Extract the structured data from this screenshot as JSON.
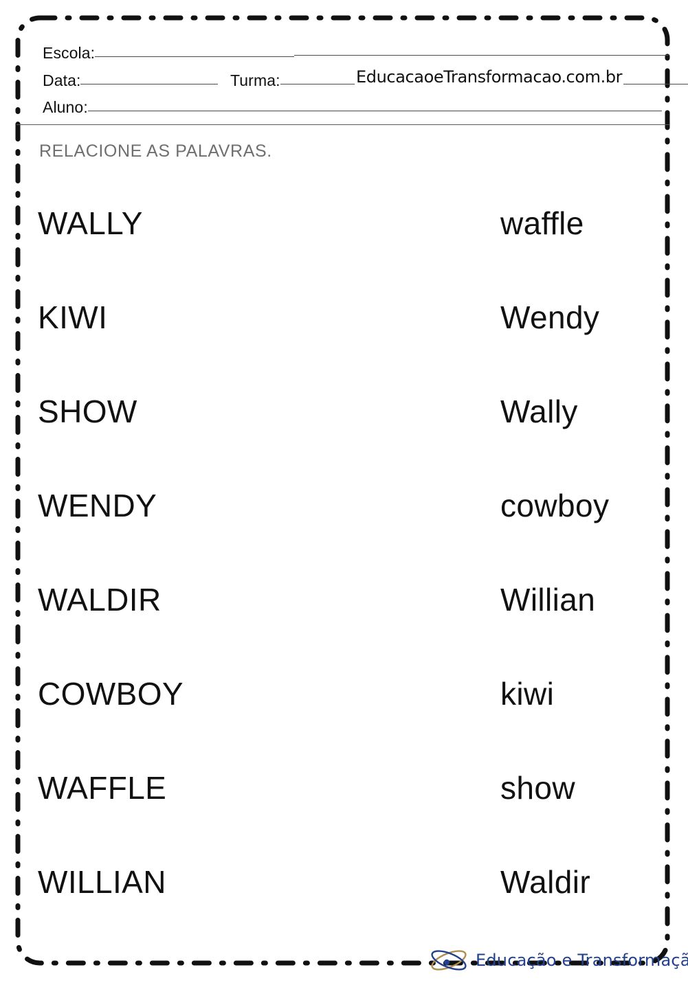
{
  "page": {
    "title": "RELACIONE AS PALAVRAS."
  },
  "header": {
    "fields": [
      {
        "label": "Escola:"
      },
      {
        "label": "Data:"
      },
      {
        "label": "Turma:"
      },
      {
        "label": "Aluno:"
      }
    ],
    "escola_label": "Escola:",
    "data_label": "Data:",
    "turma_label": "Turma:",
    "aluno_label": "Aluno:",
    "watermark": "EducacaoeTransformacao.com.br"
  },
  "instruction": "RELACIONE AS PALAVRAS.",
  "exercise": {
    "type": "matching",
    "left_column": [
      "WALLY",
      "KIWI",
      "SHOW",
      "WENDY",
      "WALDIR",
      "COWBOY",
      "WAFFLE",
      "WILLIAN"
    ],
    "right_column": [
      "waffle",
      "Wendy",
      "Wally",
      "cowboy",
      "Willian",
      "kiwi",
      "show",
      "Waldir"
    ]
  },
  "footer": {
    "logo_text": "Educação e Transformação",
    "logo_icon": "orbit-atom-icon",
    "colors": {
      "logo_blue": "#23418c",
      "logo_gold": "#b08d50"
    }
  },
  "style": {
    "border": "dash-dot rounded frame",
    "border_color": "#111111",
    "instruction_color": "#6f6f6f",
    "text_color": "#111111"
  }
}
